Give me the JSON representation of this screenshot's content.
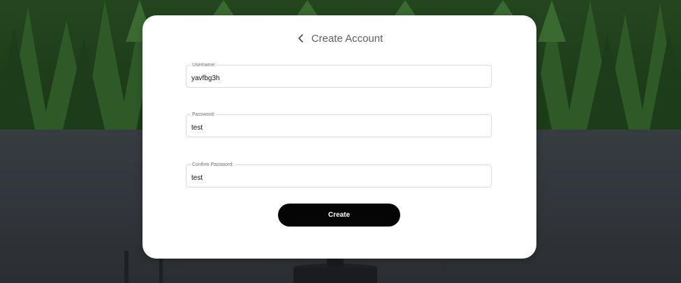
{
  "page": {
    "title": "Create Account",
    "back_icon": "chevron-left-icon"
  },
  "form": {
    "username": {
      "label": "Username:",
      "value": "yavfbg3h"
    },
    "password": {
      "label": "Password:",
      "value": "test"
    },
    "confirm_password": {
      "label": "Confirm Password:",
      "value": "test"
    },
    "submit_label": "Create"
  },
  "colors": {
    "card": "#ffffff",
    "button": "#050505",
    "button_text": "#ffffff",
    "title_text": "#5f5f5f",
    "field_border": "#dcdcdc"
  }
}
